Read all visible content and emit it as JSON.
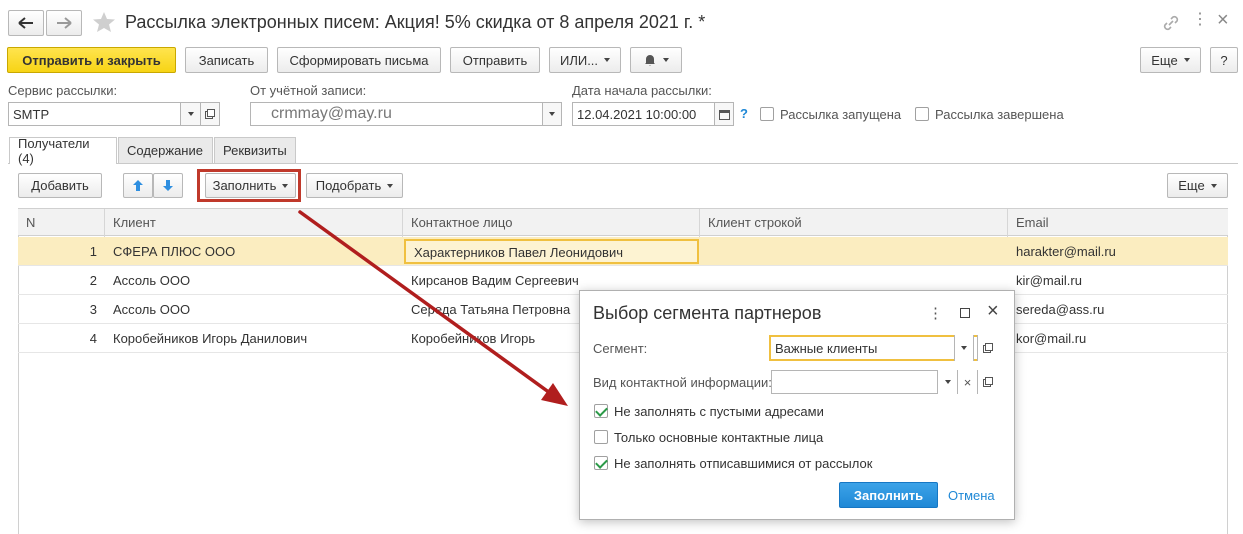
{
  "window": {
    "title": "Рассылка электронных писем: Акция! 5% скидка от 8 апреля 2021 г. *"
  },
  "toolbar": {
    "send_close": "Отправить и закрыть",
    "save": "Записать",
    "form_letters": "Сформировать письма",
    "send": "Отправить",
    "or": "ИЛИ...",
    "more": "Еще",
    "help": "?"
  },
  "fields": {
    "service_label": "Сервис рассылки:",
    "service_value": "SMTP",
    "account_label": "От учётной записи:",
    "account_value": "crmmay@may.ru",
    "date_label": "Дата начала рассылки:",
    "date_value": "12.04.2021 10:00:00",
    "help_mark": "?",
    "started_label": "Рассылка запущена",
    "finished_label": "Рассылка завершена"
  },
  "tabs": [
    "Получатели (4)",
    "Содержание",
    "Реквизиты"
  ],
  "table_toolbar": {
    "add": "Добавить",
    "fill": "Заполнить",
    "pick": "Подобрать",
    "more": "Еще"
  },
  "table": {
    "headers": [
      "N",
      "Клиент",
      "Контактное лицо",
      "Клиент строкой",
      "Email"
    ],
    "rows": [
      {
        "n": "1",
        "client": "СФЕРА ПЛЮС ООО",
        "contact": "Характерников Павел Леонидович",
        "client_str": "",
        "email": "harakter@mail.ru"
      },
      {
        "n": "2",
        "client": "Ассоль ООО",
        "contact": "Кирсанов Вадим Сергеевич",
        "client_str": "",
        "email": "kir@mail.ru"
      },
      {
        "n": "3",
        "client": "Ассоль ООО",
        "contact": "Середа Татьяна Петровна",
        "client_str": "",
        "email": "sereda@ass.ru"
      },
      {
        "n": "4",
        "client": "Коробейников Игорь Данилович",
        "contact": "Коробейников Игорь",
        "client_str": "",
        "email": "kor@mail.ru"
      }
    ]
  },
  "dialog": {
    "title": "Выбор сегмента партнеров",
    "segment_label": "Сегмент:",
    "segment_value": "Важные клиенты",
    "contact_type_label": "Вид контактной информации:",
    "contact_type_value": "",
    "opt1": "Не заполнять с пустыми адресами",
    "opt2": "Только основные контактные лица",
    "opt3": "Не заполнять отписавшимися от рассылок",
    "fill_button": "Заполнить",
    "cancel_link": "Отмена"
  },
  "colors": {
    "primary_button": "#f7d415",
    "selected_row": "#fbedc0",
    "highlight_box": "#c0392b",
    "arrow": "#b01e1e",
    "accent_blue": "#1f88d6"
  }
}
